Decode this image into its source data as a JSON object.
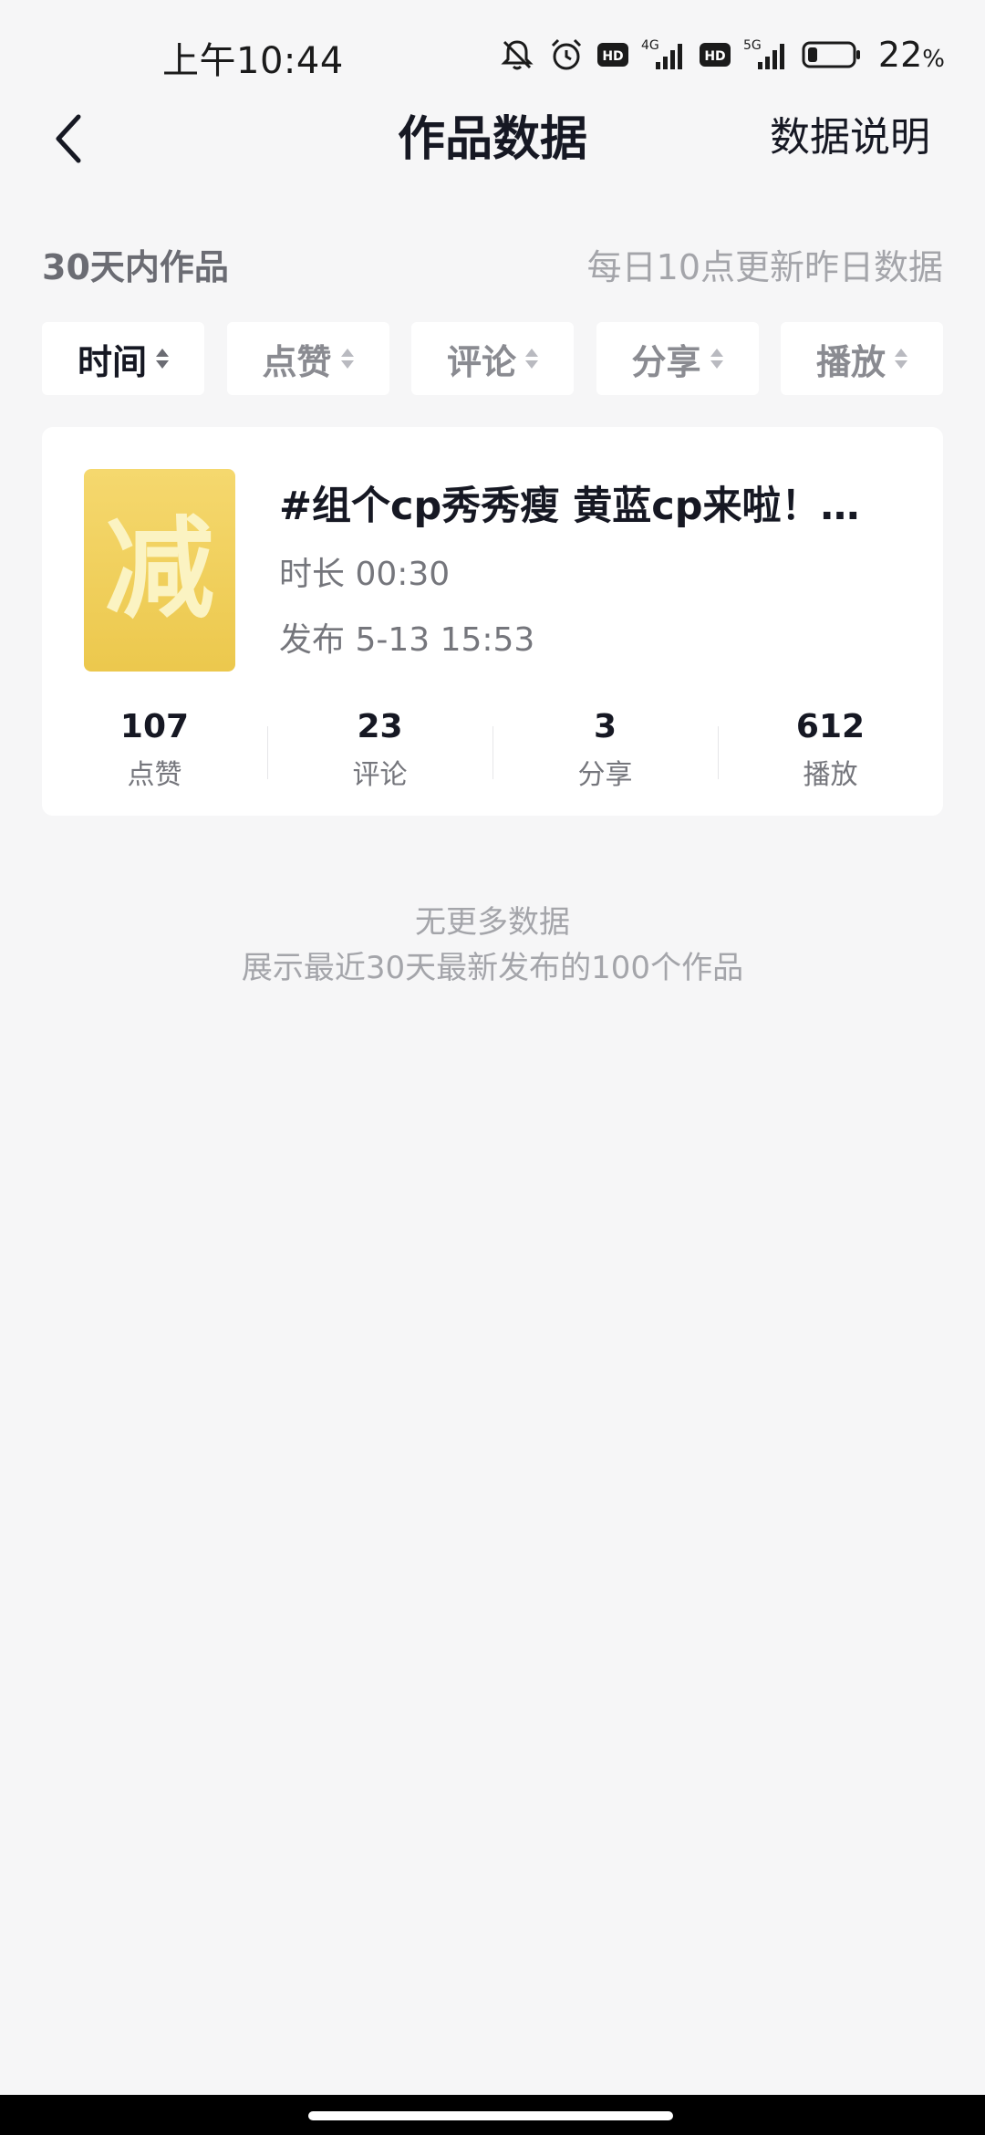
{
  "status_bar": {
    "time": "上午10:44",
    "network_1": "4G",
    "network_2": "5G",
    "battery_percent": "22",
    "battery_unit": "%",
    "battery_level": 0.22,
    "icons": [
      "mute-bell-icon",
      "alarm-icon",
      "hd-icon",
      "signal-icon",
      "hd-icon",
      "signal-icon",
      "battery-icon"
    ]
  },
  "nav": {
    "back_icon": "chevron-left-icon",
    "title": "作品数据",
    "explain": "数据说明"
  },
  "section": {
    "title": "30天内作品",
    "note": "每日10点更新昨日数据"
  },
  "sort_tabs": [
    {
      "label": "时间",
      "active": true
    },
    {
      "label": "点赞",
      "active": false
    },
    {
      "label": "评论",
      "active": false
    },
    {
      "label": "分享",
      "active": false
    },
    {
      "label": "播放",
      "active": false
    }
  ],
  "video": {
    "thumbnail_text": "减",
    "title": "#组个cp秀秀瘦 黄蓝cp来啦！…",
    "duration": "时长 00:30",
    "publish": "发布 5-13 15:53",
    "stats": [
      {
        "value": "107",
        "label": "点赞"
      },
      {
        "value": "23",
        "label": "评论"
      },
      {
        "value": "3",
        "label": "分享"
      },
      {
        "value": "612",
        "label": "播放"
      }
    ]
  },
  "footer": {
    "no_more": "无更多数据",
    "note": "展示最近30天最新发布的100个作品"
  },
  "colors": {
    "background": "#f6f6f7",
    "card": "#ffffff",
    "primary_text": "#161823",
    "secondary_text": "#75767c",
    "muted_text": "#a4a5aa",
    "thumbnail": "#ecc84d"
  }
}
